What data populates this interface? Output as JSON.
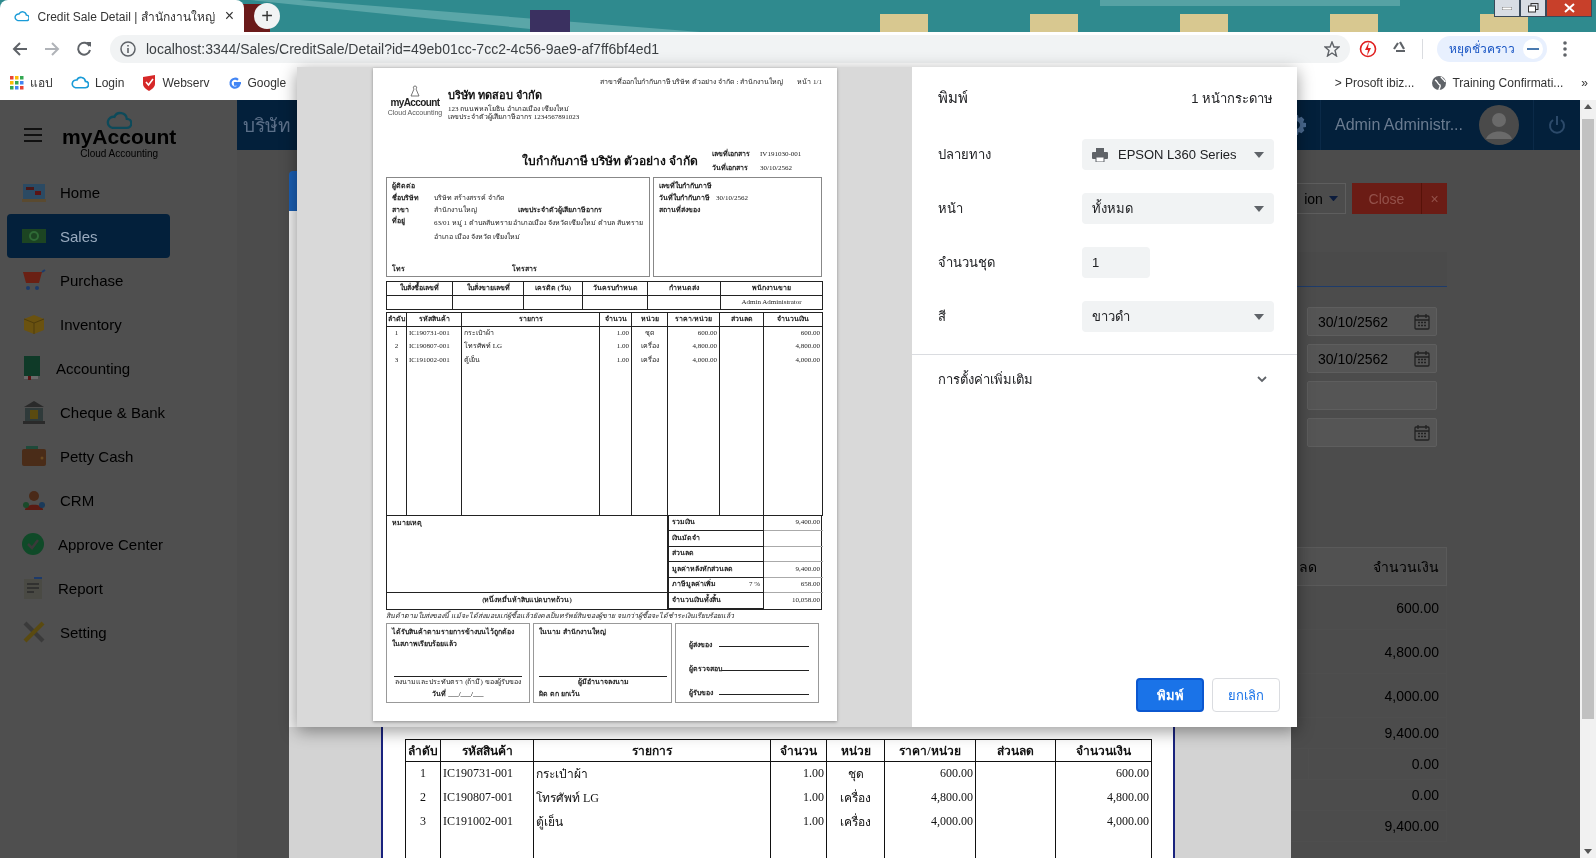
{
  "browser": {
    "tab": {
      "title": "Credit Sale Detail | สำนักงานใหญ่",
      "close": "×"
    },
    "new_tab": "+",
    "url": "localhost:3344/Sales/CreditSale/Detail?id=49eb01cc-7cc2-4c56-9ae9-af7ff6bf4ed1",
    "profile": "หยุดชั่วคราว",
    "bookmarks": [
      {
        "kind": "apps",
        "label": "แอป"
      },
      {
        "kind": "cloud",
        "label": "Login"
      },
      {
        "kind": "shield",
        "label": "Webserv"
      },
      {
        "kind": "google",
        "label": "Google"
      }
    ],
    "bookmarks_right": [
      {
        "kind": "plain",
        "label": "> Prosoft ibiz..."
      },
      {
        "kind": "globe",
        "label": "Training Confirmati..."
      }
    ],
    "more": "»"
  },
  "app": {
    "logo": {
      "brand": "myAccount",
      "tagline": "Cloud Accounting"
    },
    "sidebar": {
      "items": [
        {
          "label": "Home",
          "selected": false
        },
        {
          "label": "Sales",
          "selected": true
        },
        {
          "label": "Purchase",
          "selected": false
        },
        {
          "label": "Inventory",
          "selected": false
        },
        {
          "label": "Accounting",
          "selected": false
        },
        {
          "label": "Cheque & Bank",
          "selected": false
        },
        {
          "label": "Petty Cash",
          "selected": false
        },
        {
          "label": "CRM",
          "selected": false
        },
        {
          "label": "Approve Center",
          "selected": false
        },
        {
          "label": "Report",
          "selected": false
        },
        {
          "label": "Setting",
          "selected": false
        }
      ]
    },
    "header": {
      "company": "บริษัท",
      "user": "Admin Administr..."
    },
    "toolbar": {
      "action": "ion",
      "close": "Close",
      "close_x": "×"
    },
    "fields": [
      {
        "kind": "date",
        "value": "30/10/2562"
      },
      {
        "kind": "date",
        "value": "30/10/2562"
      },
      {
        "kind": "text"
      },
      {
        "kind": "date"
      }
    ],
    "table": {
      "columns": [
        "ลด",
        "จำนวนเงิน"
      ],
      "rows": [
        {
          "kind": "item",
          "amount": "600.00"
        },
        {
          "kind": "item",
          "amount": "4,800.00"
        },
        {
          "kind": "item",
          "amount": "4,000.00"
        },
        {
          "kind": "total",
          "amount": "9,400.00"
        },
        {
          "kind": "split",
          "amount": "0.00"
        },
        {
          "kind": "total",
          "amount": "0.00"
        },
        {
          "kind": "total",
          "amount": "9,400.00"
        }
      ]
    },
    "document": {
      "columns": [
        "ลำดับ",
        "รหัสสินค้า",
        "รายการ",
        "จำนวน",
        "หน่วย",
        "ราคา/หน่วย",
        "ส่วนลด",
        "จำนวนเงิน"
      ],
      "rows": [
        {
          "no": "1",
          "code": "IC190731-001",
          "name": "กระเป๋าผ้า",
          "qty": "1.00",
          "unit": "ชุด",
          "price": "600.00",
          "amount": "600.00"
        },
        {
          "no": "2",
          "code": "IC190807-001",
          "name": "โทรศัพท์ LG",
          "qty": "1.00",
          "unit": "เครื่อง",
          "price": "4,800.00",
          "amount": "4,800.00"
        },
        {
          "no": "3",
          "code": "IC191002-001",
          "name": "ตู้เย็น",
          "qty": "1.00",
          "unit": "เครื่อง",
          "price": "4,000.00",
          "amount": "4,000.00"
        }
      ]
    }
  },
  "print_dialog": {
    "title": "พิมพ์",
    "pages_count": "1 หน้ากระดาษ",
    "settings": [
      {
        "kind": "select",
        "label": "ปลายทาง",
        "value": "EPSON L360 Series",
        "printer": true
      },
      {
        "kind": "select",
        "label": "หน้า",
        "value": "ทั้งหมด",
        "printer": false
      },
      {
        "kind": "input",
        "label": "จำนวนชุด",
        "value": "1"
      },
      {
        "kind": "select",
        "label": "สี",
        "value": "ขาวดำ",
        "printer": false
      }
    ],
    "more_settings": "การตั้งค่าเพิ่มเติม",
    "print": "พิมพ์",
    "cancel": "ยกเลิก",
    "preview": {
      "branch_note": "สาขาที่ออกใบกำกับภาษี บริษัท ตัวอย่าง จำกัด : สำนักงานใหญ่",
      "page": "หน้า 1/1",
      "logo": {
        "brand": "myAccount",
        "tagline": "Cloud Accounting"
      },
      "company": {
        "name": "บริษัท ทดสอบ จำกัด",
        "address": "123 ถนนพหลโยธิน อำเภอเมือง เชียงใหม่",
        "tax_id": "เลขประจำตัวผู้เสียภาษีอากร 1234567891023"
      },
      "title": "ใบกำกับภาษี บริษัท ตัวอย่าง จำกัด",
      "doc_fields": [
        {
          "label": "เลขที่เอกสาร",
          "value": "IV191030-001"
        },
        {
          "label": "วันที่เอกสาร",
          "value": "30/10/2562"
        }
      ],
      "customer": {
        "contact_label": "ผู้ติดต่อ",
        "company_label": "ชื่อบริษัท",
        "company": "บริษัท สร้างสรรค์ จำกัด",
        "branch_label": "สาขา",
        "branch": "สำนักงานใหญ่",
        "tax_label": "เลขประจำตัวผู้เสียภาษีอากร",
        "address_label": "ที่อยู่",
        "address": "63/01 หมู่ 1 ตำบลสันทราย อำเภอเมือง จังหวัดเชียงใหม่ ตำบล สันทราย อำเภอ เมือง จังหวัด เชียงใหม่",
        "phone_label": "โทร",
        "fax_label": "โทรสาร"
      },
      "invoice_box": [
        {
          "label": "เลขที่ใบกำกับภาษี"
        },
        {
          "label": "วันที่ใบกำกับภาษี",
          "value": "30/10/2562"
        },
        {
          "label": "สถานที่ส่งของ"
        }
      ],
      "info_table": [
        {
          "label": "ใบสั่งซื้อเลขที่"
        },
        {
          "label": "ใบสั่งขายเลขที่"
        },
        {
          "label": "เครดิต (วัน)"
        },
        {
          "label": "วันครบกำหนด"
        },
        {
          "label": "กำหนดส่ง"
        },
        {
          "label": "พนักงานขาย",
          "value": "Admin Administrator"
        }
      ],
      "columns": [
        "ลำดับ",
        "รหัสสินค้า",
        "รายการ",
        "จำนวน",
        "หน่วย",
        "ราคา/หน่วย",
        "ส่วนลด",
        "จำนวนเงิน"
      ],
      "rows": [
        {
          "no": "1",
          "code": "IC190731-001",
          "name": "กระเป๋าผ้า",
          "qty": "1.00",
          "unit": "ชุด",
          "price": "600.00",
          "amount": "600.00"
        },
        {
          "no": "2",
          "code": "IC190807-001",
          "name": "โทรศัพท์ LG",
          "qty": "1.00",
          "unit": "เครื่อง",
          "price": "4,800.00",
          "amount": "4,800.00"
        },
        {
          "no": "3",
          "code": "IC191002-001",
          "name": "ตู้เย็น",
          "qty": "1.00",
          "unit": "เครื่อง",
          "price": "4,000.00",
          "amount": "4,000.00"
        }
      ],
      "remarks_label": "หมายเหตุ",
      "totals": [
        {
          "label": "รวมเงิน",
          "value": "9,400.00"
        },
        {
          "label": "เงินมัดจำ"
        },
        {
          "label": "ส่วนลด"
        },
        {
          "label": "มูลค่าหลังหักส่วนลด",
          "value": "9,400.00"
        },
        {
          "label": "ภาษีมูลค่าเพิ่ม",
          "rate": "7 %",
          "value": "658.00"
        }
      ],
      "grand_total": {
        "label": "จำนวนเงินทั้งสิ้น",
        "value": "10,058.00"
      },
      "amount_words": "(หนึ่งหมื่นห้าสิบแปดบาทถ้วน)",
      "note": "สินค้าตามใบส่งของนี้ แม้จะได้ส่งมอบแก่ผู้ซื้อแล้วยังคงเป็นทรัพย์สินของผู้ขาย จนกว่าผู้ซื้อจะได้ชำระเงินเรียบร้อยแล้ว",
      "receipt_box": {
        "lines": [
          "ได้รับสินค้าตามรายการข้างบนไว้ถูกต้อง",
          "ในสภาพเรียบร้อยแล้ว"
        ],
        "signature": "ลงนามและประทับตรา (ถ้ามี) ของผู้รับของ",
        "date": "วันที่ ___/___/___"
      },
      "issuer_box": {
        "title": "ในนาม สำนักงานใหญ่",
        "signature": "ผู้มีอำนาจลงนาม",
        "footer": "ผิด ตก ยกเว้น"
      },
      "sign_lines": [
        "ผู้ส่งของ",
        "ผู้ตรวจสอบ",
        "ผู้รับของ"
      ]
    }
  }
}
